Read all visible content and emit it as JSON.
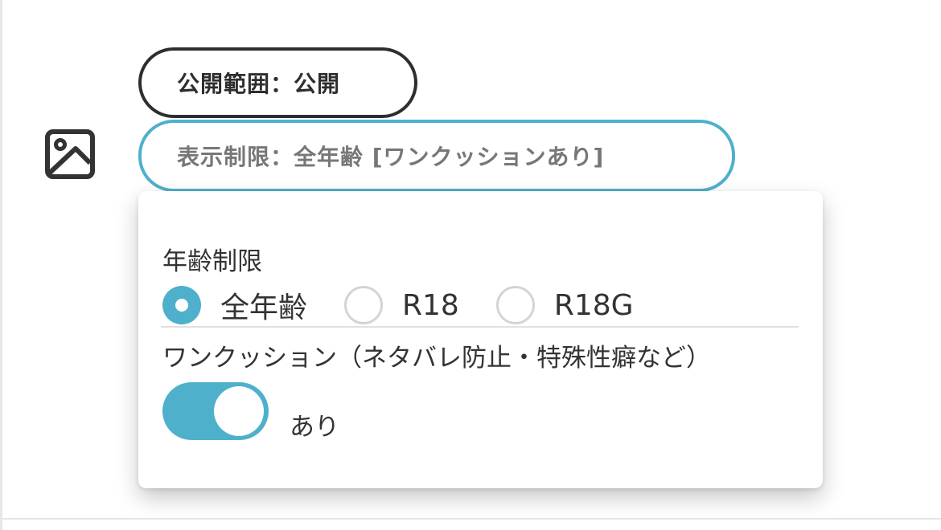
{
  "visibility_pill": {
    "label": "公開範囲：公開"
  },
  "restriction_pill": {
    "label": "表示制限：全年齢 [ワンクッションあり]"
  },
  "icons": {
    "image_icon": "image-icon"
  },
  "popover": {
    "age_restriction": {
      "label": "年齢制限",
      "options": [
        {
          "label": "全年齢",
          "selected": true
        },
        {
          "label": "R18",
          "selected": false
        },
        {
          "label": "R18G",
          "selected": false
        }
      ]
    },
    "spoiler": {
      "label": "ワンクッション（ネタバレ防止・特殊性癖など）",
      "toggle_on": true,
      "toggle_label": "あり"
    }
  },
  "colors": {
    "accent": "#4fb0cc",
    "dark_border": "#2e2e2e",
    "muted_text": "#777777"
  }
}
